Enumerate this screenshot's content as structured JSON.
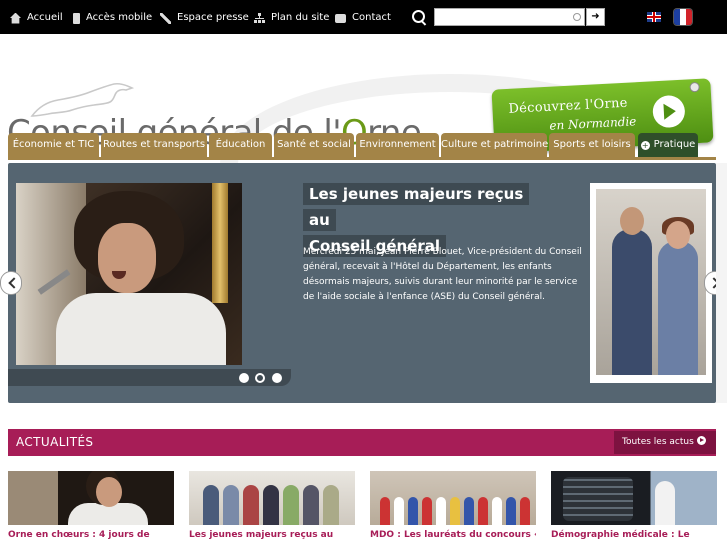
{
  "topbar": {
    "links": [
      {
        "label": "Accueil",
        "icon": "home-icon"
      },
      {
        "label": "Accès mobile",
        "icon": "mobile-icon"
      },
      {
        "label": "Espace presse",
        "icon": "pen-icon"
      },
      {
        "label": "Plan du site",
        "icon": "sitemap-icon"
      },
      {
        "label": "Contact",
        "icon": "mail-icon"
      }
    ],
    "search": {
      "value": "",
      "placeholder": "",
      "go_label": "➜"
    },
    "languages": [
      "en-flag",
      "fr-flag"
    ]
  },
  "header": {
    "title_prefix": "Conseil général de l'",
    "title_o": "O",
    "title_suffix": "rne",
    "promo": {
      "line1": "Découvrez l'Orne",
      "line2": "en Normandie"
    }
  },
  "nav": {
    "tabs": [
      {
        "label": "Économie et TIC"
      },
      {
        "label": "Routes et transports"
      },
      {
        "label": "Éducation"
      },
      {
        "label": "Santé et social"
      },
      {
        "label": "Environnement"
      },
      {
        "label": "Culture et patrimoine"
      },
      {
        "label": "Sports et loisirs"
      },
      {
        "label": "Pratique"
      }
    ]
  },
  "slider": {
    "title_line1": "Les jeunes majeurs reçus au",
    "title_line2": "Conseil général",
    "text": "Mercredi 25 mai, Jean Pierre Blouet, Vice-président du Conseil général, recevait à l'Hôtel du Département, les enfants désormais majeurs, suivis durant leur minorité par le service de l'aide sociale à l'enfance (ASE) du Conseil général.",
    "dots": 3,
    "active_dot": 2
  },
  "news": {
    "title": "ACTUALITÉS",
    "all_label": "Toutes les actus",
    "items": [
      {
        "caption": "Orne en chœurs : 4 jours de"
      },
      {
        "caption": "Les jeunes majeurs reçus au"
      },
      {
        "caption": "MDO : Les lauréats du concours «"
      },
      {
        "caption": "Démographie médicale : Le"
      }
    ]
  },
  "colors": {
    "topbar": "#000000",
    "nav_tab": "#a38447",
    "nav_pratique": "#2f4f2a",
    "slider_bg": "#556571",
    "news_accent": "#a71d57",
    "promo_green": "#6ab023"
  }
}
